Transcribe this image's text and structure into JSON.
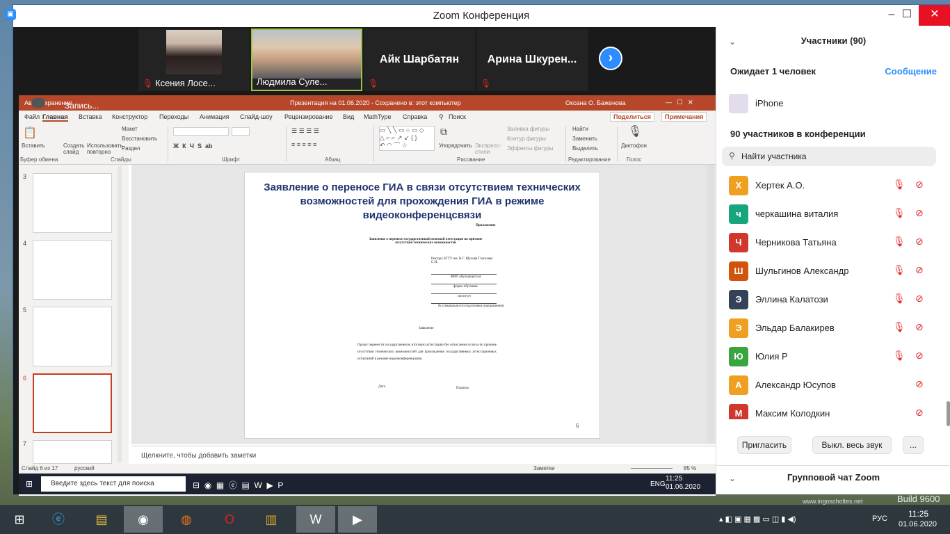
{
  "window": {
    "title": "Zoom Конференция"
  },
  "video_tiles": [
    {
      "name": "Ксения Лосе..."
    },
    {
      "name": "Людмила Суле..."
    },
    {
      "name": "Айк Шарбатян"
    },
    {
      "name": "Арина  Шкурен..."
    }
  ],
  "recording_label": "Запись...",
  "ppt": {
    "titlebar": "Презентация на 01.06.2020  -  Сохранено в: этот компьютер",
    "user": "Оксана О. Баженова",
    "autosave": "Автосохранение",
    "tabs": [
      "Файл",
      "Главная",
      "Вставка",
      "Конструктор",
      "Переходы",
      "Анимация",
      "Слайд-шоу",
      "Рецензирование",
      "Вид",
      "MathType",
      "Справка",
      "Поиск"
    ],
    "share": "Поделиться",
    "comments": "Примечания",
    "ribbon": {
      "paste": "Вставить",
      "create_slide": "Создать слайд",
      "reuse": "Использовать повторно",
      "layout": "Макет",
      "restore": "Восстановить",
      "section": "Раздел",
      "arrange": "Упорядочить",
      "quick_styles": "Экспресс-стили",
      "fill": "Заливка фигуры",
      "outline": "Контур фигуры",
      "effects": "Эффекты фигуры",
      "find": "Найти",
      "replace": "Заменить",
      "select": "Выделить",
      "dictation": "Диктофон",
      "groups": [
        "Буфер обмена",
        "Слайды",
        "Шрифт",
        "Абзац",
        "Рисование",
        "Редактирование",
        "Голос"
      ]
    },
    "thumb_numbers": [
      "3",
      "4",
      "5",
      "6",
      "7"
    ],
    "slide": {
      "title": "Заявление о переносе ГИА в связи отсутствием технических возможностей для прохождения ГИА в режиме видеоконференцсвязи",
      "appendix": "Приложение",
      "doc_heading": "Заявление о переносе государственной итоговой аттестации по причине отсутствия технических возможностей",
      "to": "Ректору БГТУ им. В.Г. Шухова Глаголеву С.Н.",
      "field1": "ФИО обучающегося",
      "field2": "форма обучения",
      "field3": "институт",
      "field4": "№ специальности подготовки (направления)",
      "statement": "Заявление",
      "body": "Прошу перенести государственную итоговую аттестацию без отчисления из вуза по причине отсутствия технических возможностей для прохождения государственных аттестационных испытаний в режиме видеоконференцсвязи.",
      "date": "Дата",
      "signature": "Подпись",
      "page": "6"
    },
    "notes_placeholder": "Щелкните, чтобы добавить заметки",
    "status_left": "Слайд 6 из 17",
    "status_lang": "русский",
    "status_notes": "Заметки",
    "zoom": "85 %",
    "inner_taskbar_search": "Введите здесь текст для поиска",
    "inner_time": "11:25",
    "inner_date": "01.06.2020",
    "inner_lang": "ENG"
  },
  "participants": {
    "header": "Участники (90)",
    "waiting": "Ожидает 1 человек",
    "message": "Сообщение",
    "waiting_device": "iPhone",
    "count_label": "90 участников в конференции",
    "search_placeholder": "Найти участника",
    "list": [
      {
        "initial": "Х",
        "name": "Хертек А.О.",
        "color": "#f0a020",
        "mic_off": true
      },
      {
        "initial": "ч",
        "name": "черкашина виталия",
        "color": "#17a67c",
        "mic_off": true
      },
      {
        "initial": "Ч",
        "name": "Черникова Татьяна",
        "color": "#d0372d",
        "mic_off": true
      },
      {
        "initial": "Ш",
        "name": "Шульгинов Александр",
        "color": "#d2540c",
        "mic_off": true
      },
      {
        "initial": "Э",
        "name": "Эллина Калатози",
        "color": "#344258",
        "mic_off": true
      },
      {
        "initial": "Э",
        "name": "Эльдар Балакирев",
        "color": "#f0a020",
        "mic_off": true
      },
      {
        "initial": "Ю",
        "name": "Юлия Р",
        "color": "#3aa43e",
        "mic_off": true
      },
      {
        "initial": "А",
        "name": "Александр Юсупов",
        "color": "#f0a020",
        "mic_off": false
      },
      {
        "initial": "М",
        "name": "Максим Колодкин",
        "color": "#d0372d",
        "mic_off": false
      }
    ],
    "invite": "Пригласить",
    "mute_all": "Выкл. весь звук",
    "more": "...",
    "chat_header": "Групповой чат Zoom"
  },
  "taskbar": {
    "lang": "РУС",
    "time": "11:25",
    "date": "01.06.2020"
  },
  "desktop_watermark": "www.ingoscholtes.net",
  "build_text": "Build 9600"
}
